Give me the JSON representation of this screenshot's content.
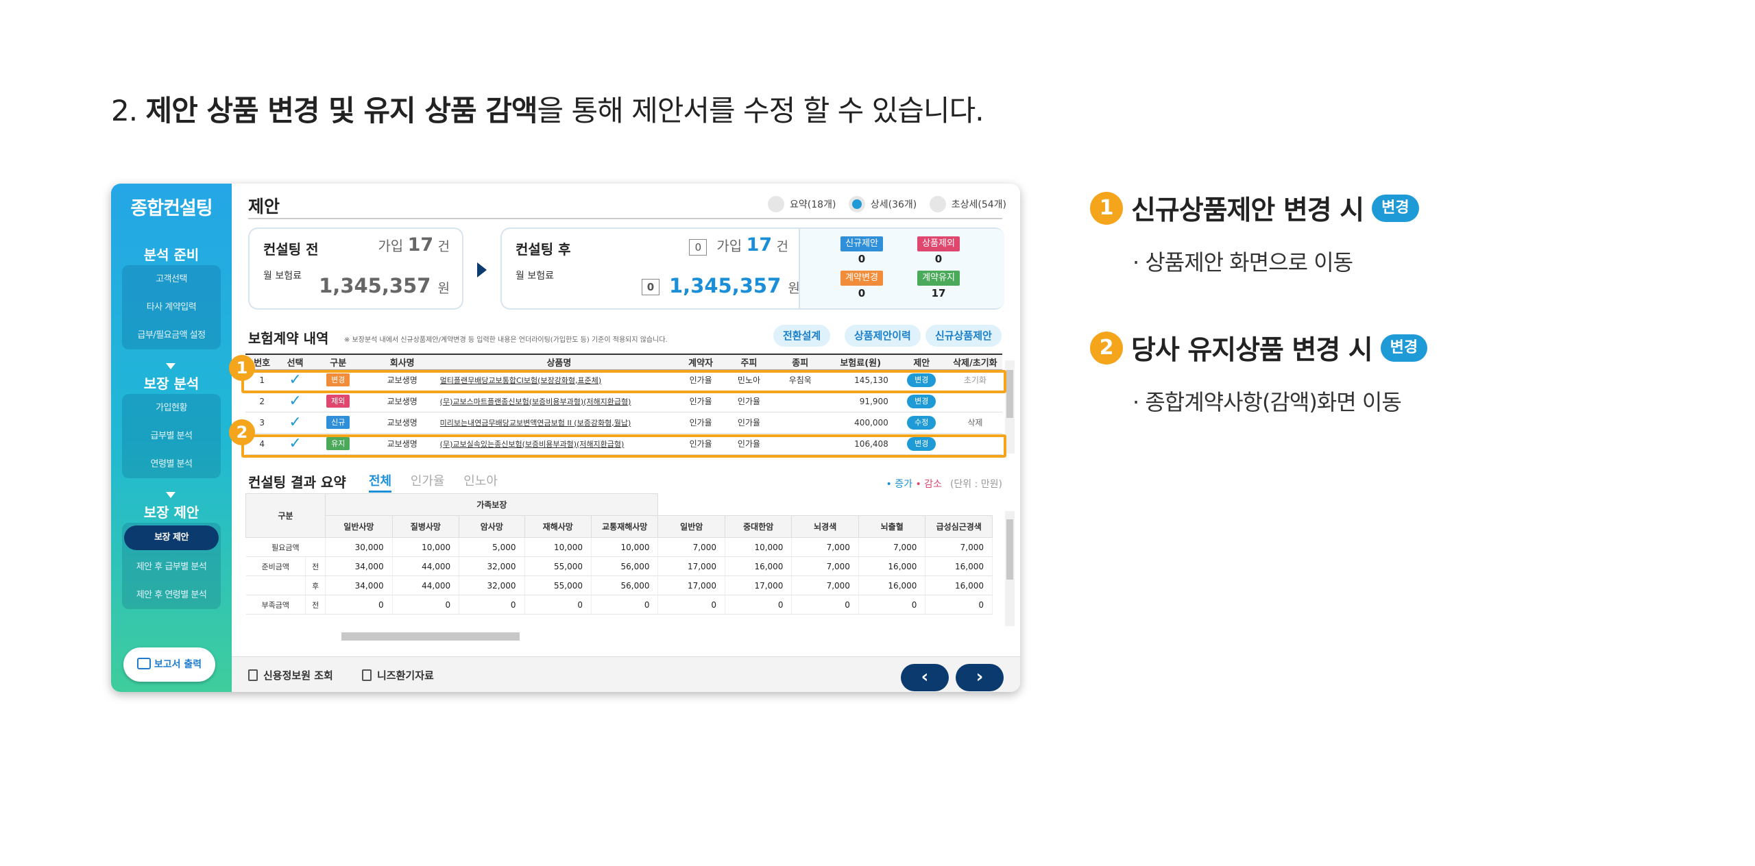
{
  "heading": {
    "prefix": "2. ",
    "bold": "제안 상품 변경 및 유지 상품 감액",
    "suffix": "을 통해 제안서를 수정 할 수 있습니다."
  },
  "sidebar": {
    "title": "종합컨설팅",
    "sections": [
      {
        "title": "분석 준비",
        "items": [
          "고객선택",
          "타사 계약입력",
          "급부/필요금액 설정"
        ]
      },
      {
        "title": "보장 분석",
        "items": [
          "가입현황",
          "급부별 분석",
          "연령별 분석"
        ]
      },
      {
        "title": "보장 제안",
        "items": [
          "보장 제안",
          "제안 후 급부별 분석",
          "제안 후 연령별 분석"
        ],
        "active": 0
      }
    ],
    "print_button": "보고서 출력"
  },
  "main": {
    "title": "제안",
    "radios": [
      {
        "label": "요약(18개)",
        "selected": false
      },
      {
        "label": "상세(36개)",
        "selected": true
      },
      {
        "label": "초상세(54개)",
        "selected": false
      }
    ],
    "before": {
      "title": "컨설팅 전",
      "count_label": "가입",
      "count": "17",
      "count_unit": "건",
      "premium_label": "월 보험료",
      "premium": "1,345,357",
      "premium_unit": "원"
    },
    "after": {
      "title": "컨설팅 후",
      "count_box": "0",
      "count_label": "가입",
      "count": "17",
      "count_unit": "건",
      "premium_label": "월 보험료",
      "premium_box": "0",
      "premium": "1,345,357",
      "premium_unit": "원"
    },
    "status": [
      {
        "label": "신규제안",
        "value": "0",
        "color": "#2f8fd8"
      },
      {
        "label": "상품제외",
        "value": "0",
        "color": "#e0476f"
      },
      {
        "label": "계약변경",
        "value": "0",
        "color": "#f08c3a"
      },
      {
        "label": "계약유지",
        "value": "17",
        "color": "#4ba95a"
      }
    ],
    "contracts": {
      "title": "보험계약 내역",
      "note": "※ 보장분석 내에서 신규상품제안/계약변경 등 입력한 내용은 언더라이팅(가입한도 등) 기준이 적용되지 않습니다.",
      "buttons": [
        "전환설계",
        "상품제안이력",
        "신규상품제안"
      ],
      "columns": [
        "번호",
        "선택",
        "구분",
        "회사명",
        "상품명",
        "계약자",
        "주피",
        "종피",
        "보험료(원)",
        "제안",
        "삭제/초기화"
      ],
      "rows": [
        {
          "no": "1",
          "type": "변경",
          "type_color": "#f08c3a",
          "company": "교보생명",
          "product": "멀티플랜무배당교보통합CI보험(보장강화형,표준체)",
          "contractor": "인가율",
          "main": "민노아",
          "sub": "우침욱",
          "premium": "145,130",
          "action": "변경",
          "extra": "초기화"
        },
        {
          "no": "2",
          "type": "제외",
          "type_color": "#e0476f",
          "company": "교보생명",
          "product": "(무)교보스마트플랜종신보험(보증비용부과형)(저해지환급형)",
          "contractor": "인가율",
          "main": "인가율",
          "sub": "",
          "premium": "91,900",
          "action": "변경",
          "extra": ""
        },
        {
          "no": "3",
          "type": "신규",
          "type_color": "#2f8fd8",
          "company": "교보생명",
          "product": "미리보는내연금무배당교보변액연금보험 II (보증강화형,월납)",
          "contractor": "인가율",
          "main": "인가율",
          "sub": "",
          "premium": "400,000",
          "action": "수정",
          "extra": "삭제"
        },
        {
          "no": "4",
          "type": "유지",
          "type_color": "#4ba95a",
          "company": "교보생명",
          "product": "(무)교보실속있는종신보험(보증비용부과형)(저해지환급형)",
          "contractor": "인가율",
          "main": "인가율",
          "sub": "",
          "premium": "106,408",
          "action": "변경",
          "extra": ""
        }
      ]
    },
    "summary": {
      "title": "컨설팅 결과 요약",
      "tabs": [
        "전체",
        "인가율",
        "인노아"
      ],
      "legend_up": "• 증가",
      "legend_down": "• 감소",
      "unit": "(단위 : 만원)",
      "group_header": "가족보장",
      "row_header": "구분",
      "columns": [
        "일반사망",
        "질병사망",
        "암사망",
        "재해사망",
        "교통재해사망",
        "일반암",
        "중대한암",
        "뇌경색",
        "뇌출혈",
        "급성심근경색"
      ],
      "rows": [
        {
          "label": "필요금액",
          "sub": "",
          "values": [
            "30,000",
            "10,000",
            "5,000",
            "10,000",
            "10,000",
            "7,000",
            "10,000",
            "7,000",
            "7,000",
            "7,000"
          ]
        },
        {
          "label": "준비금액",
          "sub": "전",
          "values": [
            "34,000",
            "44,000",
            "32,000",
            "55,000",
            "56,000",
            "17,000",
            "16,000",
            "7,000",
            "16,000",
            "16,000"
          ]
        },
        {
          "label": "",
          "sub": "후",
          "values": [
            "34,000",
            "44,000",
            "32,000",
            "55,000",
            "56,000",
            "17,000",
            "17,000",
            "7,000",
            "16,000",
            "16,000"
          ]
        },
        {
          "label": "부족금액",
          "sub": "전",
          "values": [
            "0",
            "0",
            "0",
            "0",
            "0",
            "0",
            "0",
            "0",
            "0",
            "0"
          ]
        }
      ]
    },
    "footer": {
      "links": [
        "신용정보원 조회",
        "니즈환기자료"
      ],
      "prev": "‹",
      "next": "›"
    }
  },
  "callouts": [
    {
      "num": "1",
      "title": "신규상품제안 변경 시",
      "badge": "변경",
      "desc": "· 상품제안 화면으로 이동"
    },
    {
      "num": "2",
      "title": "당사 유지상품 변경 시",
      "badge": "변경",
      "desc": "· 종합계약사항(감액)화면 이동"
    }
  ]
}
